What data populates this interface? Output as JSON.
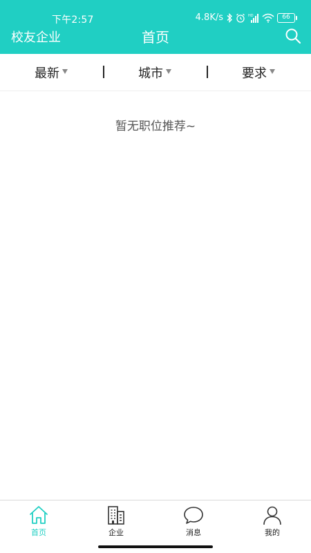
{
  "status_bar": {
    "time": "下午2:57",
    "network_speed": "4.8K/s",
    "battery": "66"
  },
  "header": {
    "left_label": "校友企业",
    "title": "首页",
    "search_icon": "search-icon"
  },
  "filters": [
    {
      "label": "最新"
    },
    {
      "label": "城市"
    },
    {
      "label": "要求"
    }
  ],
  "empty_state": {
    "text": "暂无职位推荐~"
  },
  "tabbar": {
    "items": [
      {
        "label": "首页",
        "icon": "home-icon",
        "active": true
      },
      {
        "label": "企业",
        "icon": "building-icon",
        "active": false
      },
      {
        "label": "消息",
        "icon": "chat-bubble-icon",
        "active": false
      },
      {
        "label": "我的",
        "icon": "person-icon",
        "active": false
      }
    ]
  },
  "colors": {
    "accent": "#20cfc3",
    "text": "#222222",
    "muted": "#555555"
  }
}
